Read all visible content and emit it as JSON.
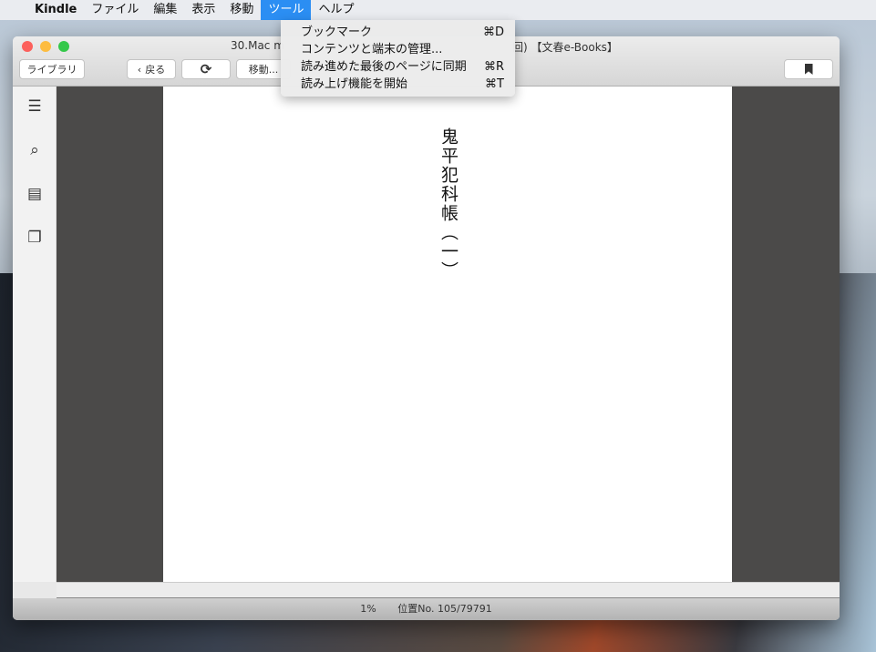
{
  "menubar": {
    "app": "Kindle",
    "items": [
      "ファイル",
      "編集",
      "表示",
      "移動",
      "ツール",
      "ヘルプ"
    ]
  },
  "window": {
    "title_left": "30.Mac m",
    "title_right": "回) 【文春e-Books】",
    "toolbar": {
      "library": "ライブラリ",
      "back": "戻る",
      "goto": "移動..."
    }
  },
  "book": {
    "text": "鬼平犯科帳（一）"
  },
  "status": {
    "percent": "1%",
    "location": "位置No. 105/79791"
  },
  "tools_menu": [
    {
      "label": "ブックマーク",
      "shortcut": "⌘D"
    },
    {
      "label": "コンテンツと端末の管理...",
      "shortcut": ""
    },
    {
      "label": "読み進めた最後のページに同期",
      "shortcut": "⌘R"
    },
    {
      "label": "読み上げ機能を開始",
      "shortcut": "⌘T"
    }
  ]
}
